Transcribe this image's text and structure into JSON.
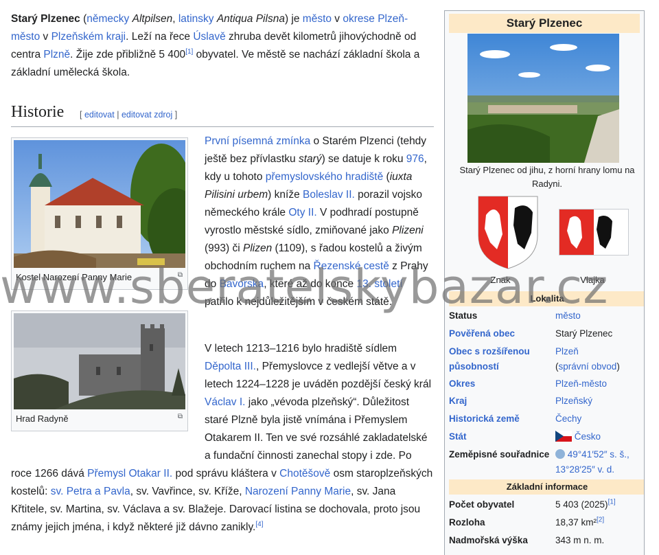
{
  "intro": {
    "bold_name": "Starý Plzenec",
    "t1": " (",
    "l_nemecky": "německy",
    "altpilsen": "Altpilsen",
    "t2": ", ",
    "l_latinsky": "latinsky",
    "antiqua": "Antiqua Pilsna",
    "t3": ") je ",
    "l_mesto": "město",
    "t4": " v ",
    "l_okres": "okrese Plzeň-město",
    "t5": " v ",
    "l_kraj": "Plzeňském kraji",
    "t6": ". Leží na řece ",
    "l_uslava": "Úslavě",
    "t7": " zhruba devět kilometrů jihovýchodně od centra ",
    "l_plzne": "Plzně",
    "t8": ". Žije zde přibližně 5 400",
    "ref1": "[1]",
    "t9": " obyvatel. Ve městě se nachází základní škola a základní umělecká škola."
  },
  "heading": {
    "title": "Historie",
    "open": "[ ",
    "edit": "editovat",
    "sep": " | ",
    "edit_source": "editovat zdroj",
    "close": " ]"
  },
  "figures": {
    "church_caption": "Kostel Narození Panny Marie",
    "castle_caption": "Hrad Radyně"
  },
  "history": {
    "l_zminka": "První písemná zmínka",
    "a1": " o Starém Plzenci (tehdy ještě bez přívlastku ",
    "stary": "starý",
    "a2": ") se datuje k roku ",
    "l_976": "976",
    "a3": ", kdy u tohoto ",
    "l_hradiste": "přemyslovského hradiště",
    "a4": " (",
    "iuxta": "iuxta Pilisini urbem",
    "a5": ") kníže ",
    "l_boleslav": "Boleslav II.",
    "a6": " porazil vojsko německého krále ",
    "l_oty": "Oty II.",
    "a7": " V podhradí postupně vyrostlo městské sídlo, zmiňované jako ",
    "plizeni": "Plizeni",
    "a8": " (993) či ",
    "plizen": "Plizen",
    "a9": " (1109), s řadou kostelů a živým obchodním ruchem na ",
    "l_rezenska": "Řezenské cestě",
    "a10": " z Prahy do ",
    "l_bavorska": "Bavorska",
    "a11": ", které až do konce ",
    "l_stoleti": "13. století",
    "a12": " patřilo k nejdůležitějším v českém státě.",
    "b1": "V letech 1213–1216 bylo hradiště sídlem ",
    "l_depolt": "Děpolta III.",
    "b2": ", Přemyslovce z vedlejší větve a v letech 1224–1228 je uváděn pozdější český král ",
    "l_vaclav": "Václav I.",
    "b3": " jako „vévoda plzeňský“. Důležitost staré Plzně byla jistě vnímána i Přemyslem Otakarem II. Ten ve své rozsáhlé zakladatelské a fundační činnosti zanechal stopy i zde. Po roce 1266 dává ",
    "l_premysl": "Přemysl Otakar II.",
    "b4": " pod správu kláštera v ",
    "l_chotesov": "Chotěšově",
    "b5": " osm staroplzeňských kostelů: ",
    "l_petra": "sv. Petra a Pavla",
    "b6": ", sv. Vavřince, sv. Kříže, ",
    "l_narozeni": "Narození Panny Marie",
    "b7": ", sv. Jana Křtitele, sv. Martina, sv. Václava a sv. Blažeje. Darovací listina se dochovala, proto jsou známy jejich jména, i když některé již dávno zanikly.",
    "ref4": "[4]"
  },
  "infobox": {
    "title": "Starý Plzenec",
    "photo_caption": "Starý Plzenec od jihu, z horní hrany lomu na Radyni.",
    "coat_label": "Znak",
    "flag_label": "Vlajka",
    "section_lokalita": "Lokalita",
    "section_zakladni": "Základní informace",
    "rows": {
      "status_k": "Status",
      "status_v": "město",
      "poverena_k": "Pověřená obec",
      "poverena_v": "Starý Plzenec",
      "orp_k": "Obec s rozšířenou působností",
      "orp_v": "Plzeň",
      "orp_v2": "(",
      "orp_v3": "správní obvod",
      "orp_v4": ")",
      "okres_k": "Okres",
      "okres_v": "Plzeň-město",
      "kraj_k": "Kraj",
      "kraj_v": "Plzeňský",
      "zeme_k": "Historická země",
      "zeme_v": "Čechy",
      "stat_k": "Stát",
      "stat_v": "Česko",
      "souradnice_k": "Zeměpisné souřadnice",
      "souradnice_v1": "49°41′52″ s. š.,",
      "souradnice_v2": "13°28′25″ v. d.",
      "obyvatel_k": "Počet obyvatel",
      "obyvatel_v": "5 403 (2025)",
      "obyvatel_ref": "[1]",
      "rozloha_k": "Rozloha",
      "rozloha_v": "18,37 km²",
      "rozloha_ref": "[2]",
      "vyska_k": "Nadmořská výška",
      "vyska_v": "343 m n. m."
    }
  },
  "watermark": "www.sberatelskybazar.cz",
  "colors": {
    "link": "#3366cc",
    "infobox_header": "#fde9c7",
    "flag_red": "#e32b24"
  }
}
